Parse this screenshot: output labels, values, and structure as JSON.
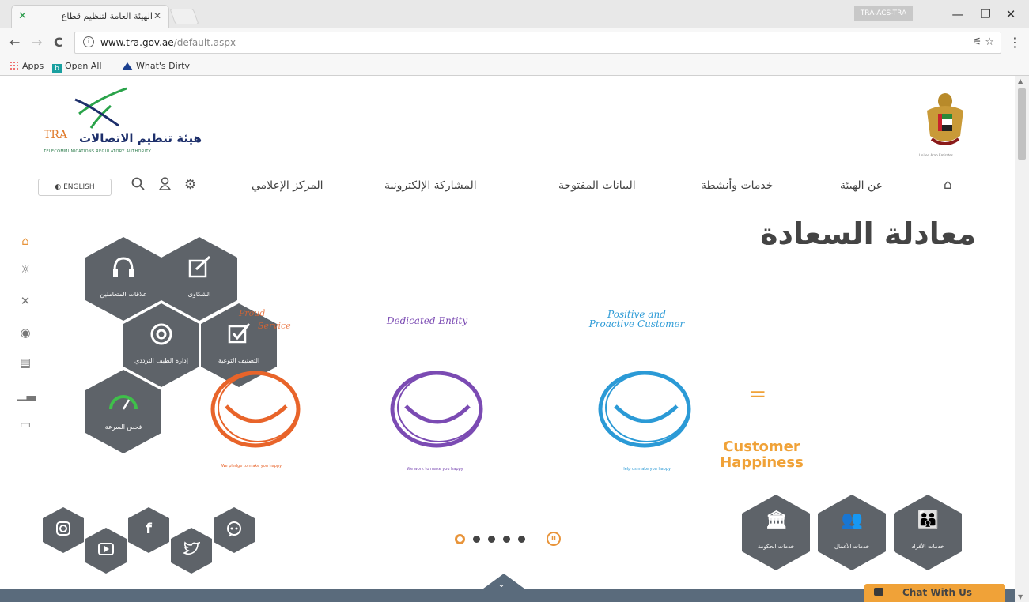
{
  "browser": {
    "tab_title": "الهيئة العامة لتنظيم قطاع",
    "tab_close": "✕",
    "user_badge": "TRA-ACS-TRA",
    "win_minimize": "—",
    "win_maximize": "❐",
    "win_close": "✕",
    "back": "←",
    "forward": "→",
    "reload": "C",
    "url_host": "www.tra.gov.ae",
    "url_path": "/default.aspx",
    "omnibox_icons": "⚟ ☆",
    "menu": "⋮",
    "bookmarks": [
      "Apps",
      "Open All",
      "What's Dirty"
    ]
  },
  "site": {
    "logo_arabic": "هيئة تنظيم الاتصالات",
    "logo_tra": "TRA",
    "logo_english": "TELECOMMUNICATIONS REGULATORY AUTHORITY",
    "emblem_caption": "United Arab Emirates"
  },
  "header": {
    "language_button": "◐ ENGLISH",
    "nav": [
      "المركز الإعلامي",
      "المشاركة الإلكترونية",
      "البيانات المفتوحة",
      "خدمات وأنشطة",
      "عن الهيئة"
    ]
  },
  "hero": {
    "headline": "معادلة السعادة",
    "hex_menu": [
      "الشكاوى",
      "علاقات المتعاملين",
      "التصنيف التوعية",
      "إدارة الطيف الترددي",
      "فحص السرعة"
    ],
    "hex_overlay_fragment": [
      "Proud",
      "Service"
    ],
    "smileys": [
      {
        "caption": "",
        "sub": "We pledge to make you happy",
        "color": "#e8642a"
      },
      {
        "caption": "Dedicated Entity",
        "sub": "We work to make you happy",
        "color": "#7b4bb3"
      },
      {
        "caption": "Positive and Proactive Customer",
        "sub": "Help us make you happy",
        "color": "#2b9ad6"
      }
    ],
    "equals": "=",
    "result": "Customer Happiness"
  },
  "carousel": {
    "pause_label": "II"
  },
  "services": [
    "خدمات الحكومة",
    "خدمات الأعمال",
    "خدمات الأفراد"
  ],
  "chat": {
    "label": "Chat With Us"
  },
  "colors": {
    "accent": "#f0a238",
    "hex_gray": "#5e6369",
    "orange_smile": "#e8642a",
    "purple_smile": "#7b4bb3",
    "blue_smile": "#2b9ad6"
  }
}
